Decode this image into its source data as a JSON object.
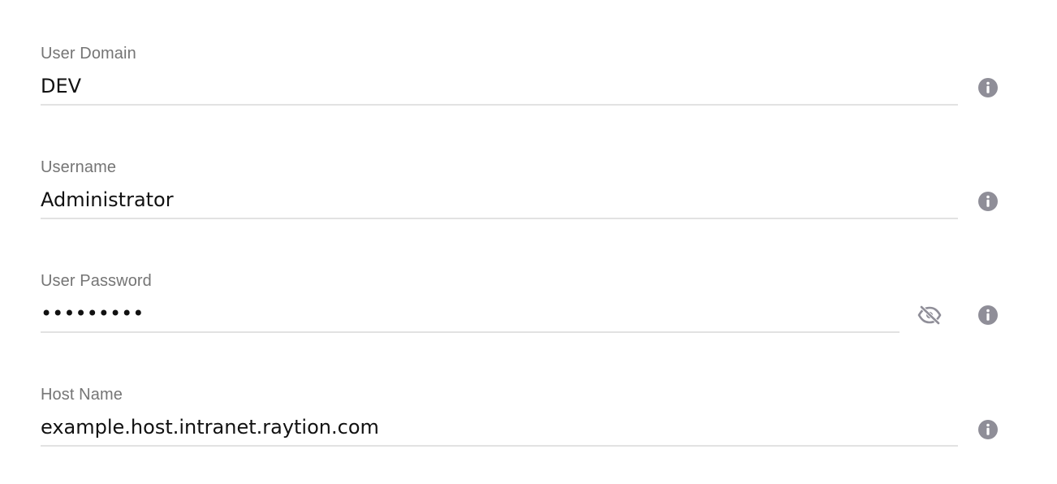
{
  "fields": [
    {
      "label": "User Domain",
      "value": "DEV",
      "type": "text",
      "icons": [
        "info-icon"
      ]
    },
    {
      "label": "Username",
      "value": "Administrator",
      "type": "text",
      "icons": [
        "info-icon"
      ]
    },
    {
      "label": "User Password",
      "value": "•••••••••",
      "type": "password",
      "icons": [
        "eye-off-icon",
        "info-icon"
      ]
    },
    {
      "label": "Host Name",
      "value": "example.host.intranet.raytion.com",
      "type": "text",
      "icons": [
        "info-icon"
      ]
    }
  ],
  "colors": {
    "label": "#757575",
    "text": "#111111",
    "underline": "#e2e2e2",
    "icon": "#8f8e98"
  }
}
